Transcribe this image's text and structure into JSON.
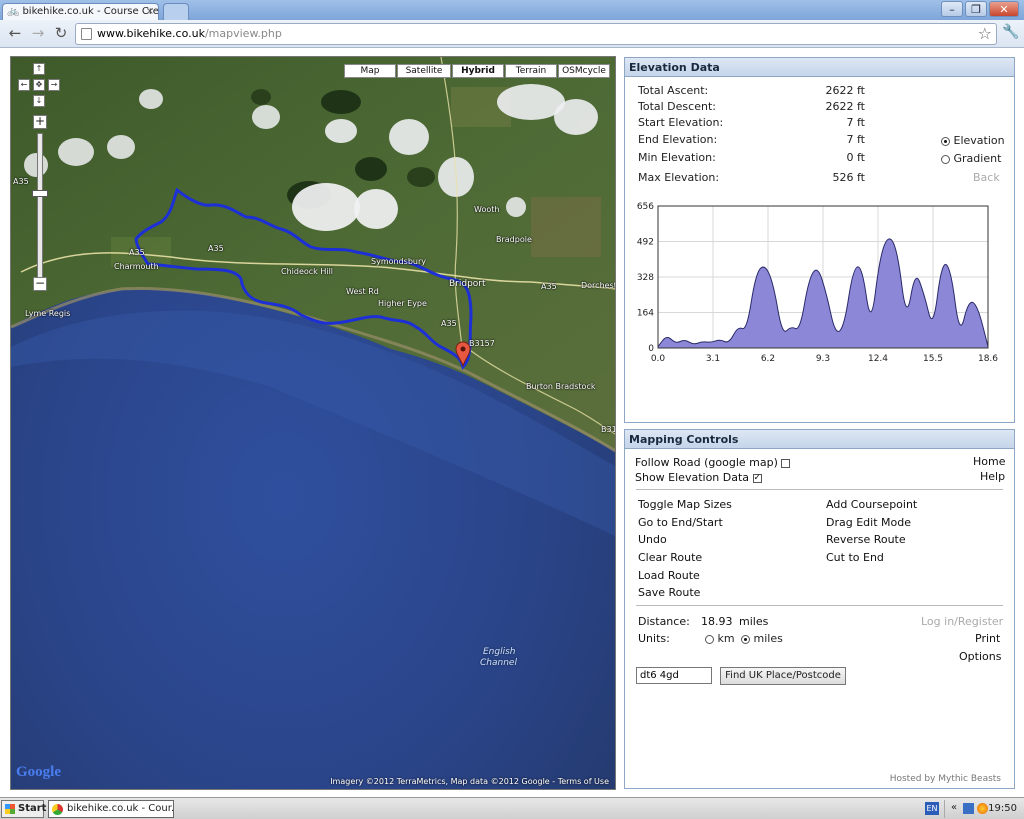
{
  "browser": {
    "tab_title": "bikehike.co.uk - Course Creat",
    "url_host": "www.bikehike.co.uk",
    "url_path": "/mapview.php"
  },
  "map": {
    "types": [
      "Map",
      "Satellite",
      "Hybrid",
      "Terrain",
      "OSMcycle"
    ],
    "active_type": "Hybrid",
    "labels": {
      "lyme_regis": "Lyme Regis",
      "charmouth": "Charmouth",
      "symondsbury": "Symondsbury",
      "bridport": "Bridport",
      "wooth": "Wooth",
      "bradpole": "Bradpole",
      "higher_eype": "Higher Eype",
      "west_rd": "West Rd",
      "chideock_hill": "Chideock Hill",
      "burton_bradstock": "Burton Bradstock",
      "dorchester_rd": "Dorchester",
      "a35_1": "A35",
      "a35_2": "A35",
      "a35_3": "A35",
      "a35_4": "A35",
      "a35_5": "A35",
      "b3157": "B3157",
      "b31": "B31",
      "english_channel_1": "English",
      "english_channel_2": "Channel"
    },
    "google_logo": "Google",
    "attribution": "Imagery ©2012 TerraMetrics, Map data ©2012 Google - Terms of Use"
  },
  "elevation": {
    "title": "Elevation Data",
    "stats": [
      {
        "label": "Total Ascent:",
        "value": "2622 ft"
      },
      {
        "label": "Total Descent:",
        "value": "2622 ft"
      },
      {
        "label": "Start Elevation:",
        "value": "7 ft"
      },
      {
        "label": "End Elevation:",
        "value": "7 ft"
      },
      {
        "label": "Min Elevation:",
        "value": "0 ft"
      },
      {
        "label": "Max Elevation:",
        "value": "526 ft"
      }
    ],
    "mode_elevation": "Elevation",
    "mode_gradient": "Gradient",
    "selected_mode": "Elevation",
    "back_label": "Back"
  },
  "chart_data": {
    "type": "area",
    "x": [
      0.0,
      0.5,
      1.0,
      1.5,
      2.0,
      2.5,
      3.0,
      3.5,
      4.0,
      4.5,
      5.0,
      5.5,
      6.0,
      6.5,
      7.0,
      7.5,
      8.0,
      8.5,
      9.0,
      9.5,
      10.0,
      10.5,
      11.0,
      11.5,
      12.0,
      12.5,
      13.0,
      13.5,
      14.0,
      14.5,
      15.0,
      15.5,
      16.0,
      16.5,
      17.0,
      17.5,
      18.0,
      18.6
    ],
    "y": [
      7,
      60,
      20,
      40,
      15,
      30,
      25,
      40,
      20,
      100,
      80,
      340,
      390,
      300,
      60,
      100,
      80,
      320,
      380,
      250,
      60,
      100,
      370,
      380,
      90,
      420,
      526,
      450,
      120,
      360,
      250,
      80,
      400,
      370,
      50,
      220,
      200,
      7
    ],
    "xticks": [
      "0.0",
      "3.1",
      "6.2",
      "9.3",
      "12.4",
      "15.5",
      "18.6"
    ],
    "yticks": [
      "0",
      "164",
      "328",
      "492",
      "656"
    ],
    "xlim": [
      0,
      18.6
    ],
    "ylim": [
      0,
      656
    ],
    "grid": true,
    "fill_color": "#8c87d6",
    "line_color": "#2a2a6a"
  },
  "controls": {
    "title": "Mapping Controls",
    "follow_road": "Follow Road (google map)",
    "follow_road_checked": false,
    "show_elevation": "Show Elevation Data",
    "show_elevation_checked": true,
    "home": "Home",
    "help": "Help",
    "left_links": [
      "Toggle Map Sizes",
      "Go to End/Start",
      "Undo",
      "Clear Route",
      "Load Route",
      "Save Route"
    ],
    "right_links": [
      "Add Coursepoint",
      "Drag Edit Mode",
      "Reverse Route",
      "Cut to End"
    ],
    "distance_label": "Distance:",
    "distance_value": "18.93",
    "distance_unit": "miles",
    "units_label": "Units:",
    "unit_km": "km",
    "unit_miles": "miles",
    "selected_unit": "miles",
    "login": "Log in/Register",
    "print": "Print",
    "options": "Options",
    "postcode_value": "dt6 4gd",
    "find_button": "Find UK Place/Postcode",
    "hosted_by": "Hosted by Mythic Beasts"
  },
  "taskbar": {
    "start": "Start",
    "task_item": "bikehike.co.uk - Cour...",
    "lang": "EN",
    "clock": "19:50"
  }
}
